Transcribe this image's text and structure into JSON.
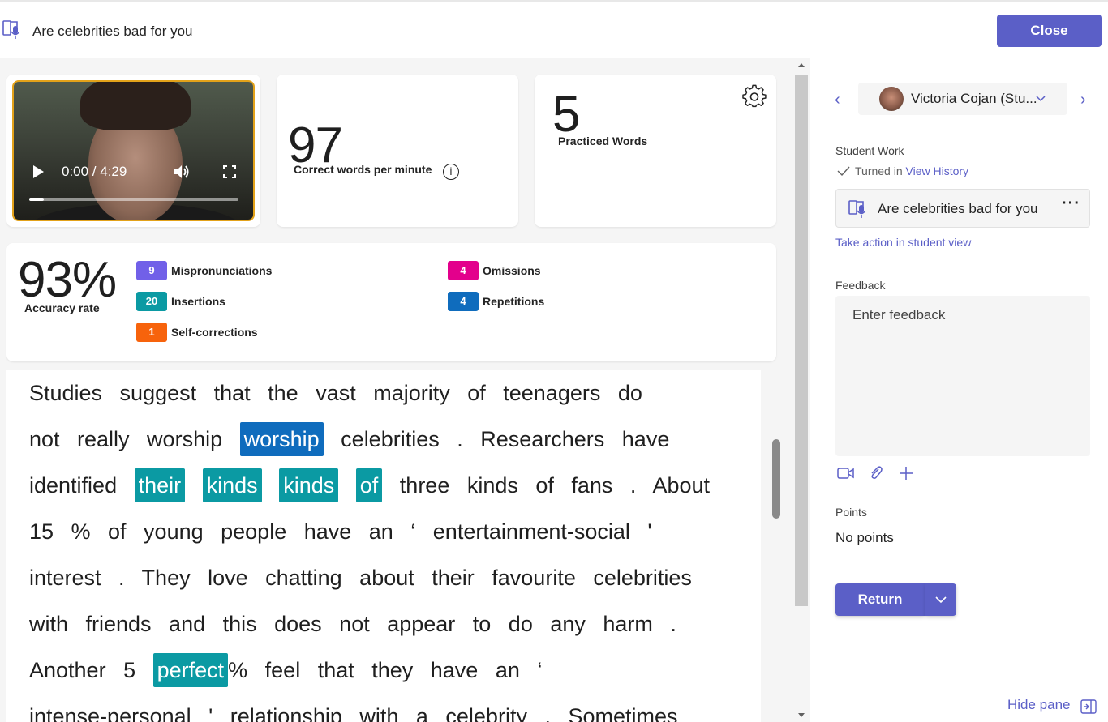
{
  "header": {
    "title": "Are celebrities bad for you",
    "close_label": "Close"
  },
  "video": {
    "time": "0:00 / 4:29",
    "progress_fraction": 0.07
  },
  "metrics": {
    "wpm_value": "97",
    "wpm_label": "Correct words per minute",
    "info_glyph": "i",
    "practiced_value": "5",
    "practiced_label": "Practiced Words",
    "accuracy_value": "93%",
    "accuracy_label": "Accuracy rate",
    "stats": [
      {
        "count": "9",
        "label": "Mispronunciations",
        "color": "#7160e8"
      },
      {
        "count": "4",
        "label": "Omissions",
        "color": "#e3008c"
      },
      {
        "count": "20",
        "label": "Insertions",
        "color": "#0b9aa3"
      },
      {
        "count": "4",
        "label": "Repetitions",
        "color": "#0f6cbd"
      },
      {
        "count": "1",
        "label": "Self-corrections",
        "color": "#f7630c"
      }
    ]
  },
  "passage": {
    "l1": "Studies suggest that the vast majority of teenagers do",
    "l2a": "not really worship",
    "l2_hl": "worship",
    "l2b": "celebrities . Researchers have",
    "l3a": "identified",
    "l3_hl1": "their",
    "l3_hl2": "kinds",
    "l3_hl3": "kinds",
    "l3_hl4": "of",
    "l3b": "three kinds of fans . About",
    "l4": "15 % of young people have an ‘ entertainment-social '",
    "l5": "interest . They love chatting about their favourite celebrities",
    "l6": "with friends and this does not appear to do any harm .",
    "l7a": "Another 5",
    "l7_hl": "perfect",
    "l7b": "% feel that they have an ‘",
    "l8": "intense-personal ' relationship with a celebrity . Sometimes"
  },
  "pane": {
    "student_name": "Victoria Cojan (Stu...",
    "student_work_label": "Student Work",
    "turned_in_label": "Turned in",
    "view_history": "View History",
    "work_item_name": "Are celebrities bad for you",
    "more_glyph": "···",
    "take_action": "Take action in student view",
    "feedback_label": "Feedback",
    "feedback_placeholder": "Enter feedback",
    "points_label": "Points",
    "points_value": "No points",
    "return_label": "Return",
    "hide_pane": "Hide pane"
  },
  "icons": {
    "app": "reading-progress-icon",
    "play": "play-icon",
    "volume": "volume-icon",
    "fullscreen": "fullscreen-icon",
    "settings": "gear-icon",
    "info": "info-icon",
    "prev": "chevron-left-icon",
    "next": "chevron-right-icon",
    "dropdown": "chevron-down-icon",
    "check": "checkmark-icon",
    "video": "video-camera-icon",
    "attach": "paperclip-icon",
    "add": "plus-icon",
    "hide": "hide-pane-icon"
  },
  "colors": {
    "accent": "#5b5fc7",
    "highlight_blue": "#0f6cbd",
    "highlight_teal": "#0b9aa3",
    "video_border": "#e3a21a"
  }
}
